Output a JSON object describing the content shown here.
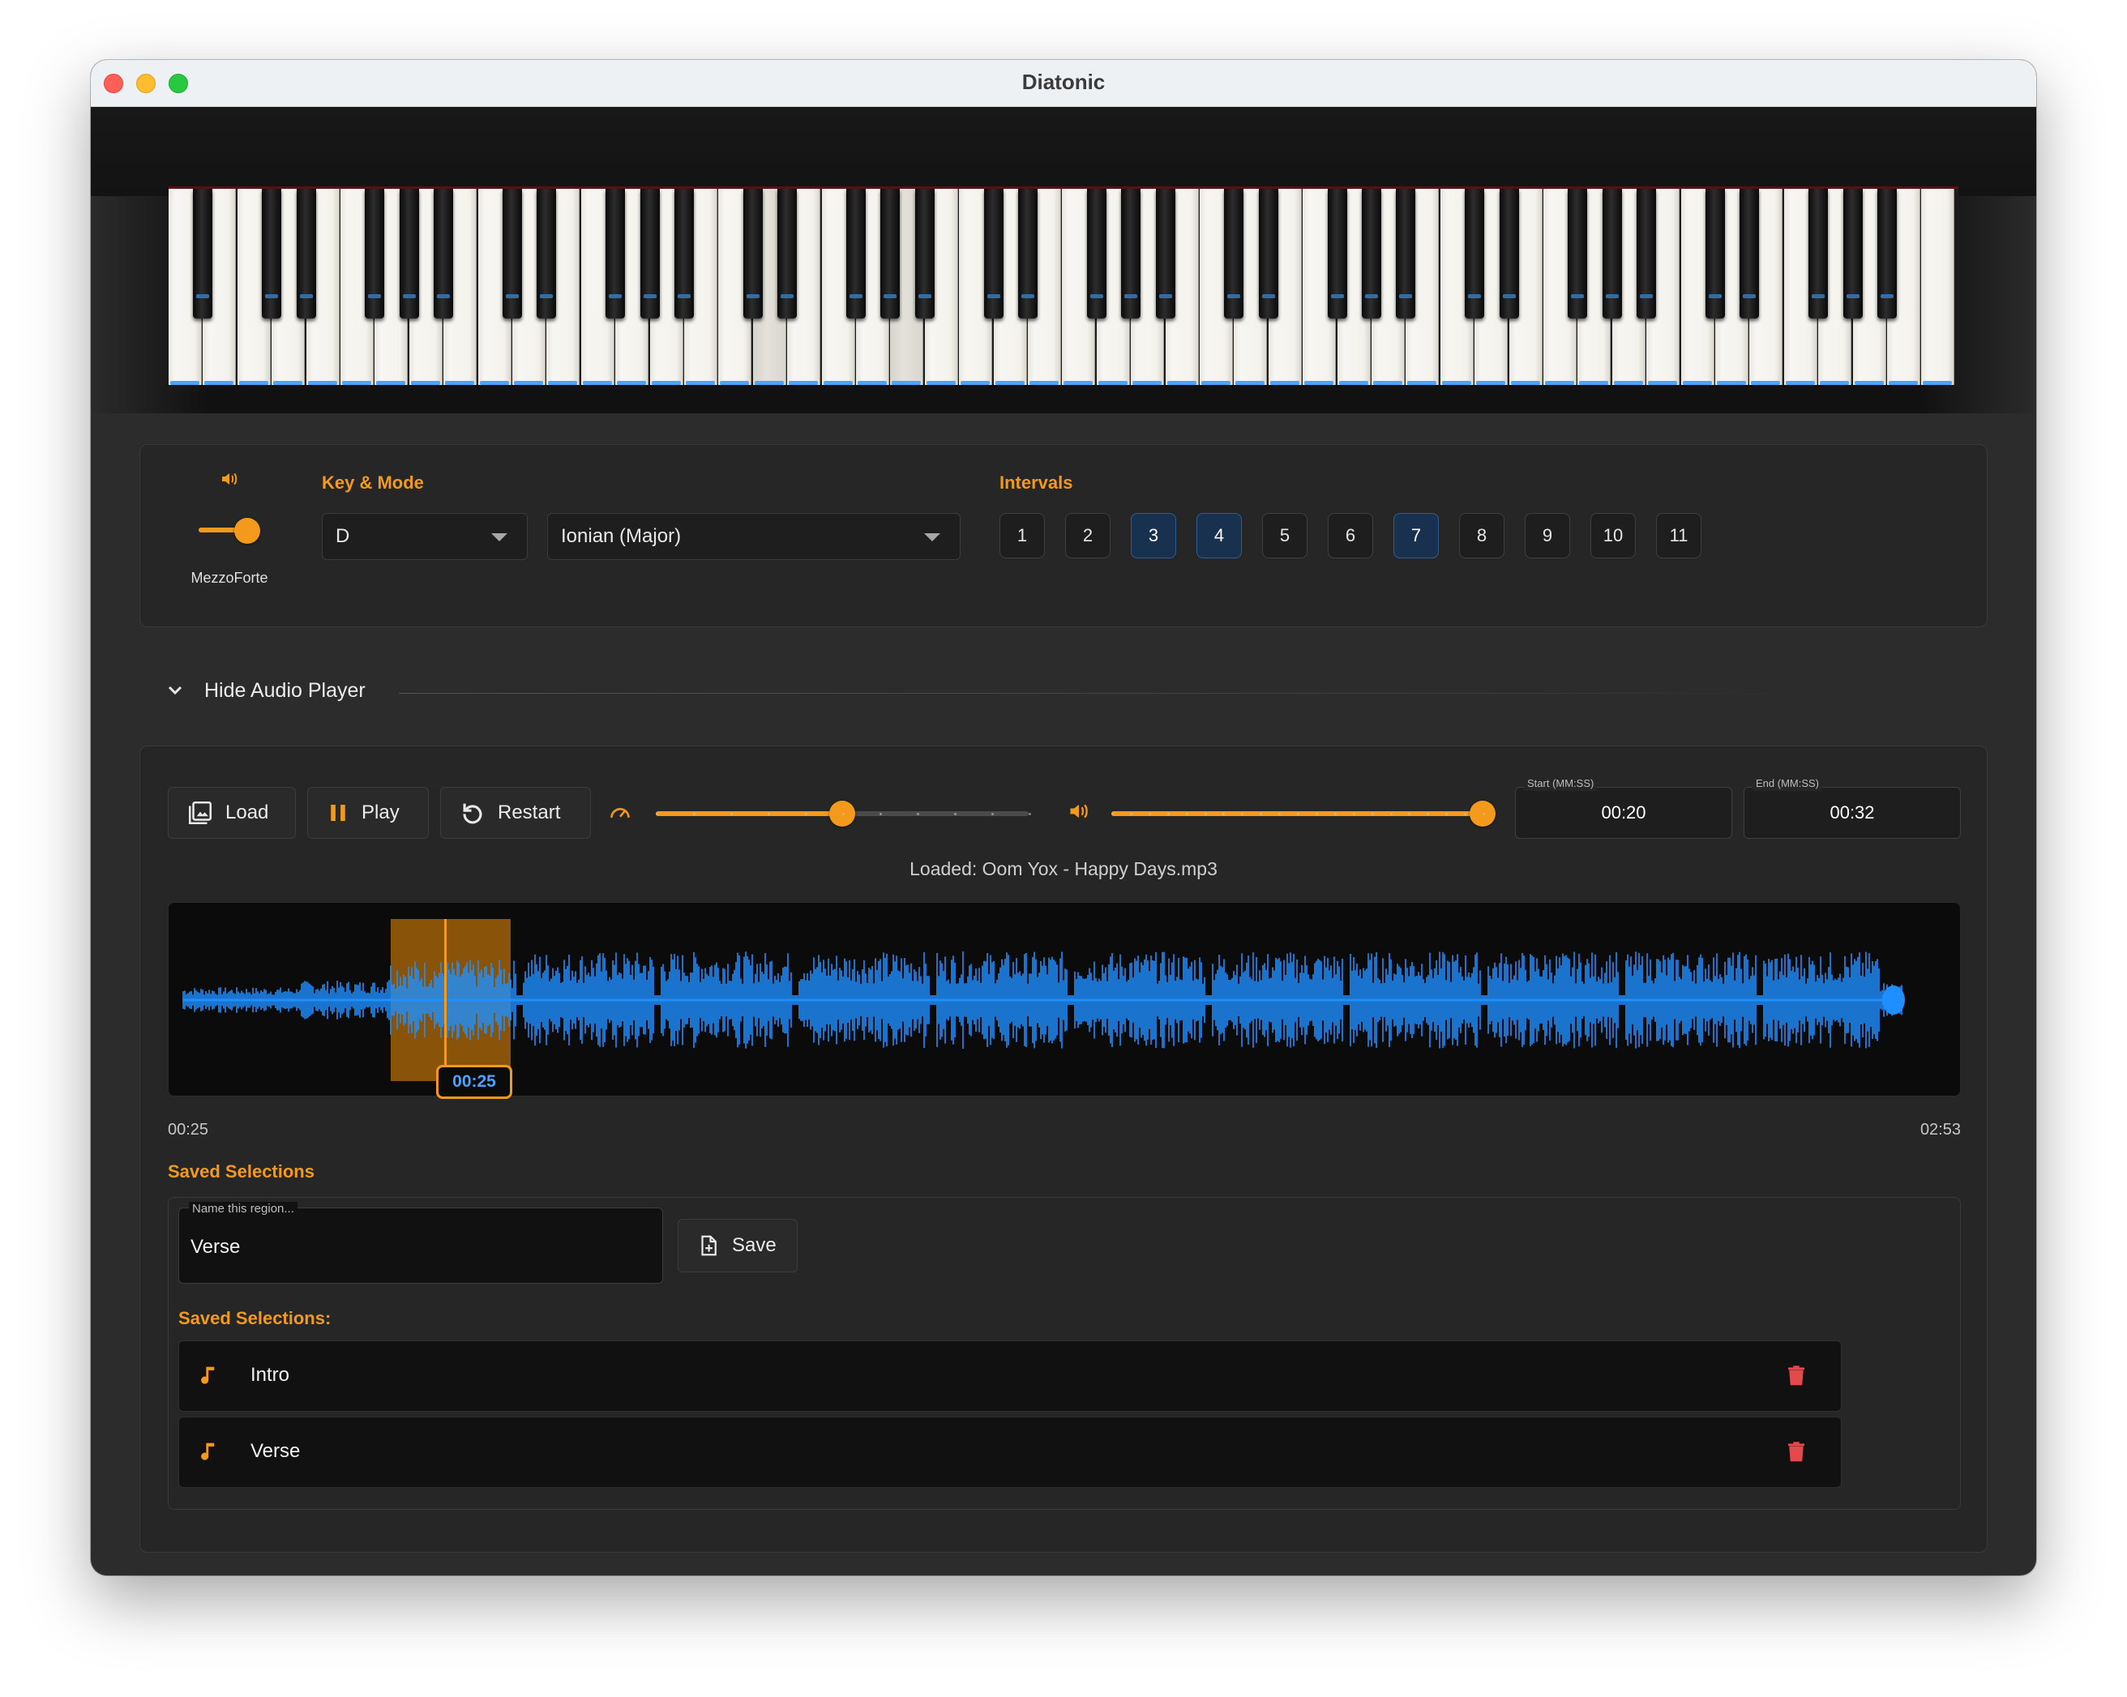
{
  "window": {
    "title": "Diatonic"
  },
  "volume": {
    "label": "MezzoForte",
    "level": 0.65
  },
  "key_mode": {
    "label": "Key & Mode",
    "key": "D",
    "mode": "Ionian (Major)"
  },
  "intervals": {
    "label": "Intervals",
    "items": [
      {
        "label": "1",
        "active": false
      },
      {
        "label": "2",
        "active": false
      },
      {
        "label": "3",
        "active": true
      },
      {
        "label": "4",
        "active": true
      },
      {
        "label": "5",
        "active": false
      },
      {
        "label": "6",
        "active": false
      },
      {
        "label": "7",
        "active": true
      },
      {
        "label": "8",
        "active": false
      },
      {
        "label": "9",
        "active": false
      },
      {
        "label": "10",
        "active": false
      },
      {
        "label": "11",
        "active": false
      }
    ]
  },
  "audio_toggle": {
    "label": "Hide Audio Player"
  },
  "player": {
    "load_label": "Load",
    "play_label": "Play",
    "restart_label": "Restart",
    "speed_level": 0.5,
    "volume_level": 1.0,
    "start_caption": "Start (MM:SS)",
    "start_value": "00:20",
    "end_caption": "End (MM:SS)",
    "end_value": "00:32",
    "loaded_text": "Loaded: Oom Yox - Happy Days.mp3",
    "playhead_label": "00:25",
    "time_left": "00:25",
    "time_right": "02:53"
  },
  "saved": {
    "section_title": "Saved Selections",
    "name_caption": "Name this region...",
    "name_value": "Verse",
    "save_label": "Save",
    "list_title": "Saved Selections:",
    "items": [
      {
        "name": "Intro"
      },
      {
        "name": "Verse"
      }
    ]
  },
  "colors": {
    "accent": "#f39a1d",
    "waveform": "#1f8fff",
    "active_interval": "#17314e",
    "delete": "#e5484d"
  }
}
